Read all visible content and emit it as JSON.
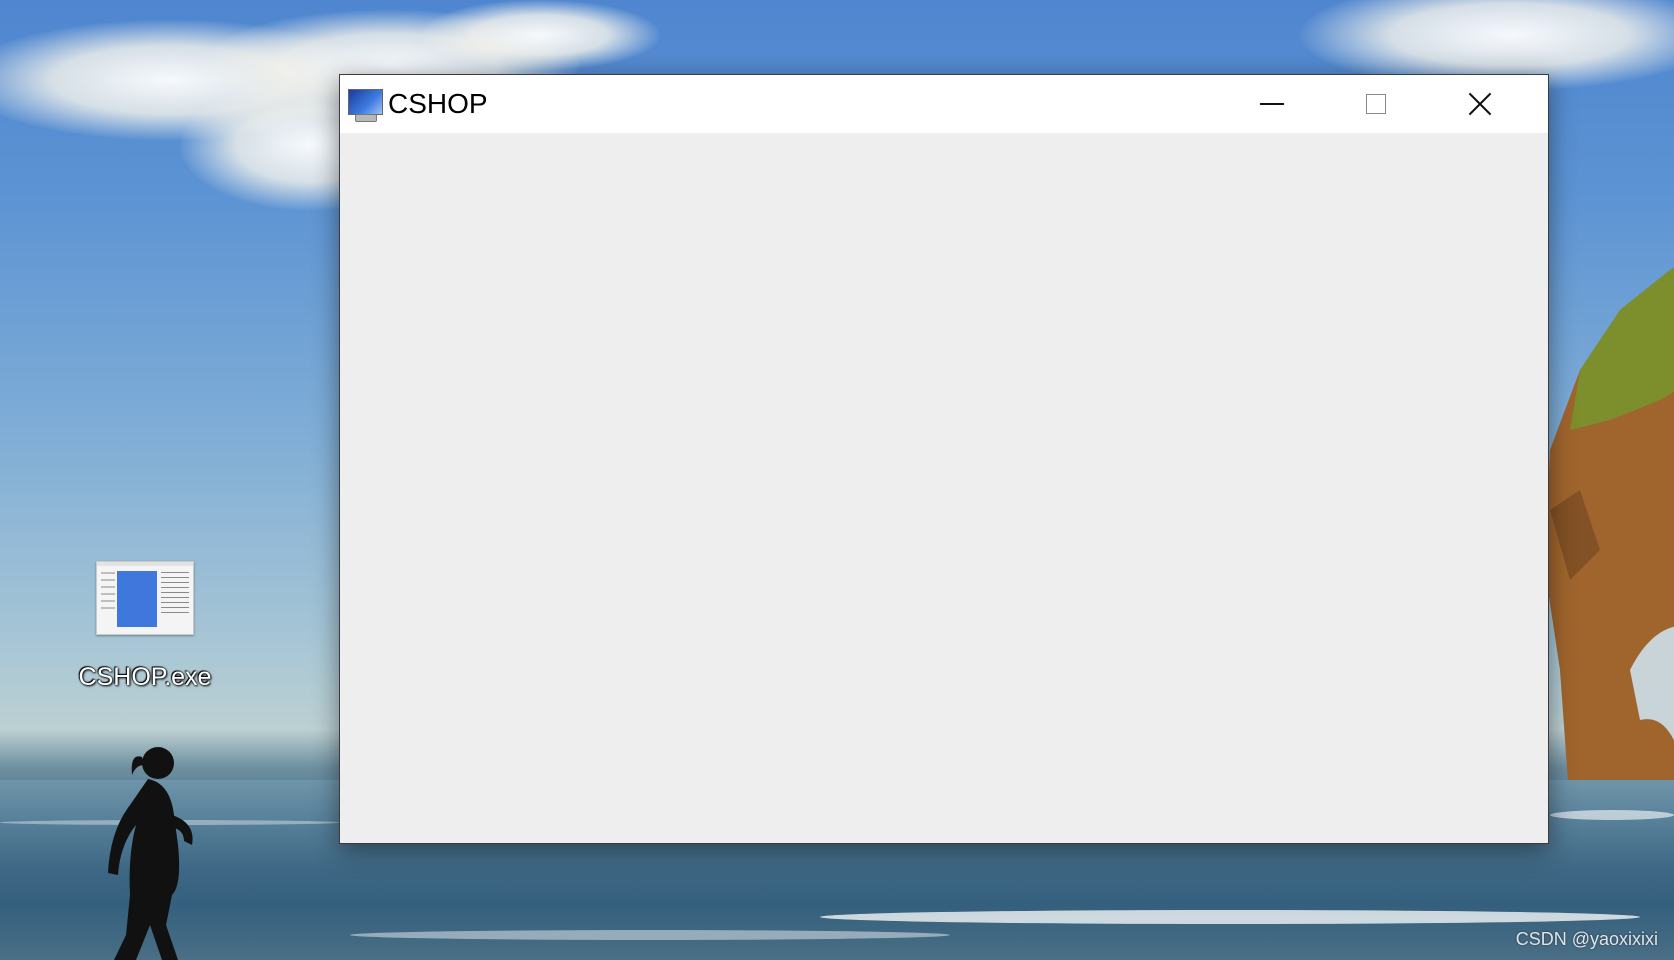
{
  "desktop": {
    "icon_label": "CSHOP.exe",
    "watermark": "CSDN @yaoxixixi"
  },
  "window": {
    "title": "CSHOP",
    "icons": {
      "app": "monitor-icon",
      "minimize": "minimize-icon",
      "maximize": "maximize-icon",
      "close": "close-icon"
    }
  }
}
